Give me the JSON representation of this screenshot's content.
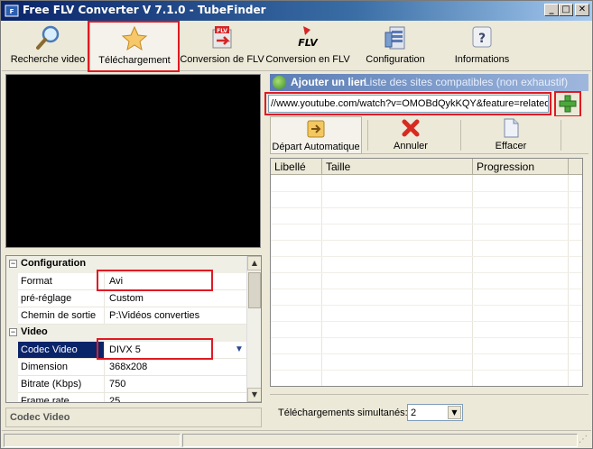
{
  "window": {
    "title": "Free FLV Converter V 7.1.0 - TubeFinder",
    "min_symbol": "_",
    "max_symbol": "□",
    "close_symbol": "✕"
  },
  "toolbar": {
    "items": [
      {
        "label": "Recherche video",
        "icon": "magnifier-icon"
      },
      {
        "label": "Téléchargement",
        "icon": "star-download-icon",
        "active": true
      },
      {
        "label": "Conversion de FLV",
        "icon": "flv-convert-icon"
      },
      {
        "label": "Conversion en FLV",
        "icon": "flv-logo-icon"
      },
      {
        "label": "Configuration",
        "icon": "config-tools-icon"
      },
      {
        "label": "Informations",
        "icon": "help-question-icon"
      }
    ]
  },
  "properties": {
    "categories": [
      "Configuration",
      "Video"
    ],
    "rows": [
      {
        "name": "Format",
        "value": "Avi"
      },
      {
        "name": "pré-réglage",
        "value": "Custom"
      },
      {
        "name": "Chemin de sortie",
        "value": "P:\\Vidéos converties"
      },
      {
        "name": "Codec Video",
        "value": "DIVX 5",
        "selected": true
      },
      {
        "name": "Dimension",
        "value": "368x208"
      },
      {
        "name": "Bitrate (Kbps)",
        "value": "750"
      },
      {
        "name": "Frame rate",
        "value": "25"
      }
    ],
    "description_title": "Codec Video"
  },
  "download": {
    "header_title": "Ajouter un lien",
    "header_link": "Liste des sites compatibles (non exhaustif)",
    "url_value": "//www.youtube.com/watch?v=OMOBdQykKQY&feature=related",
    "add_symbol": "+",
    "actions": [
      {
        "label": "Départ Automatique",
        "icon": "start-arrow-icon"
      },
      {
        "label": "Annuler",
        "icon": "cancel-x-icon"
      },
      {
        "label": "Effacer",
        "icon": "clear-page-icon"
      }
    ],
    "columns": [
      "Libellé",
      "Taille",
      "Progression"
    ],
    "simultaneous_label": "Téléchargements simultanés:",
    "simultaneous_value": "2"
  },
  "colors": {
    "highlight": "#e01a22",
    "selection": "#0a246a"
  }
}
